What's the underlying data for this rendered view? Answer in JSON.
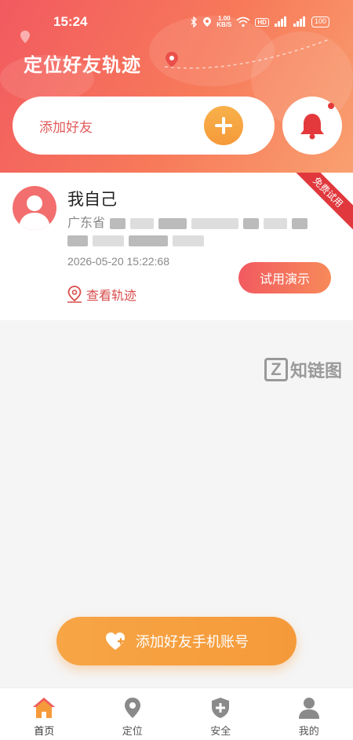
{
  "status_bar": {
    "time": "15:24",
    "net_speed_value": "1.00",
    "net_speed_unit": "KB/S",
    "hd_label": "HD",
    "battery": "100"
  },
  "header": {
    "title": "定位好友轨迹",
    "add_friend_label": "添加好友"
  },
  "friend_card": {
    "name": "我自己",
    "address_line1_prefix": "广东省",
    "timestamp": "2026-05-20 15:22:68",
    "view_track_label": "查看轨迹",
    "trial_button_label": "试用演示",
    "ribbon_label": "免费试用"
  },
  "watermark": {
    "mark": "Z",
    "text": "知链图"
  },
  "add_phone_button": {
    "label": "添加好友手机账号"
  },
  "tabs": [
    {
      "label": "首页",
      "icon": "home-icon",
      "active": true
    },
    {
      "label": "定位",
      "icon": "location-pin-icon",
      "active": false
    },
    {
      "label": "安全",
      "icon": "shield-icon",
      "active": false
    },
    {
      "label": "我的",
      "icon": "person-icon",
      "active": false
    }
  ],
  "colors": {
    "accent_red": "#f25a60",
    "accent_orange": "#f59a3a",
    "ribbon": "#e0383c"
  }
}
